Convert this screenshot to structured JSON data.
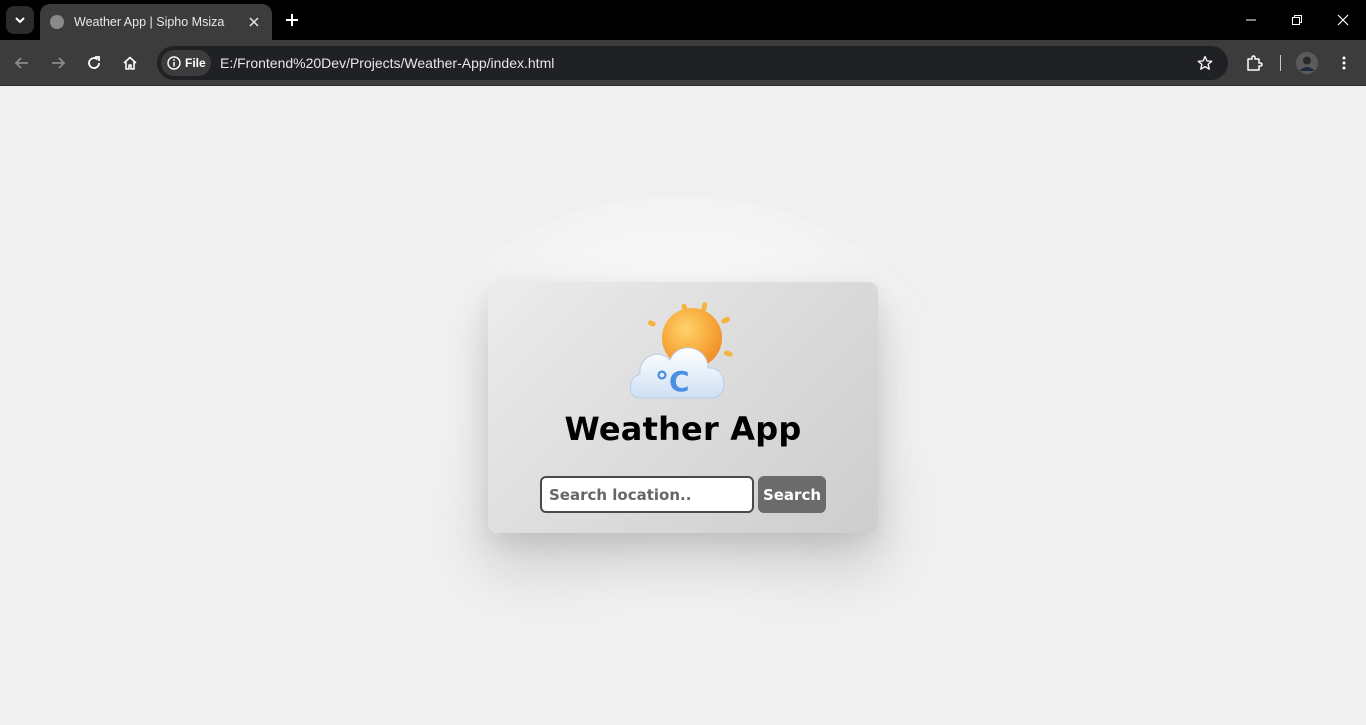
{
  "browser": {
    "tab": {
      "title": "Weather App | Sipho Msiza"
    },
    "omnibox": {
      "site_chip": "File",
      "url": "E:/Frontend%20Dev/Projects/Weather-App/index.html"
    }
  },
  "page": {
    "title": "Weather App",
    "search": {
      "placeholder": "Search location..",
      "value": ""
    },
    "search_button_label": "Search",
    "icon": "sun-cloud-celsius-icon",
    "icon_text": "°C"
  },
  "colors": {
    "page_background": "#f0f0f0",
    "card_background": "#dcdcdc",
    "button_background": "#6b6b6b",
    "sun": "#f5a623",
    "cloud": "#e6f0fb",
    "celsius": "#4a90e2"
  }
}
